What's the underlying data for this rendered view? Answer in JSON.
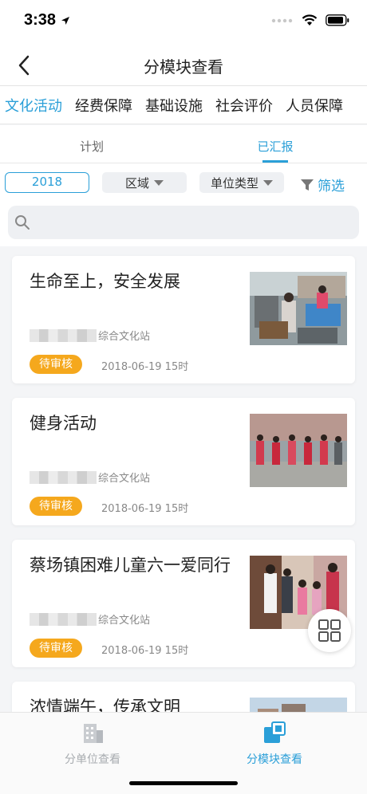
{
  "status": {
    "time": "3:38"
  },
  "header": {
    "title": "分模块查看"
  },
  "module_tabs": [
    {
      "label": "文化活动",
      "active": true
    },
    {
      "label": "经费保障",
      "active": false
    },
    {
      "label": "基础设施",
      "active": false
    },
    {
      "label": "社会评价",
      "active": false
    },
    {
      "label": "人员保障",
      "active": false
    }
  ],
  "sub_tabs": [
    {
      "label": "计划",
      "active": false
    },
    {
      "label": "已汇报",
      "active": true
    }
  ],
  "filters": {
    "year": "2018",
    "region": "区域",
    "unit_type": "单位类型",
    "filter_label": "筛选"
  },
  "search": {
    "placeholder": ""
  },
  "cards": [
    {
      "title": "生命至上，安全发展",
      "org": "综合文化站",
      "status": "待审核",
      "date": "2018-06-19 15时"
    },
    {
      "title": "健身活动",
      "org": "综合文化站",
      "status": "待审核",
      "date": "2018-06-19 15时"
    },
    {
      "title": "蔡场镇困难儿童六一爱同行",
      "org": "综合文化站",
      "status": "待审核",
      "date": "2018-06-19 15时"
    },
    {
      "title": "浓情端午，传承文明",
      "org": "",
      "status": "",
      "date": ""
    }
  ],
  "bottom_nav": [
    {
      "label": "分单位查看",
      "icon": "building-icon",
      "active": false
    },
    {
      "label": "分模块查看",
      "icon": "module-icon",
      "active": true
    }
  ],
  "colors": {
    "accent": "#2a9fd8",
    "badge": "#f5a81d"
  }
}
